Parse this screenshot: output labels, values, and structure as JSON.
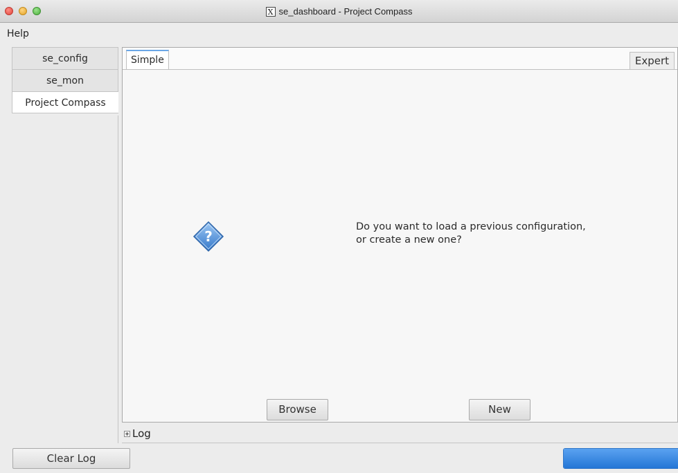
{
  "window": {
    "title": "se_dashboard - Project Compass",
    "app_icon": "x11-icon"
  },
  "menu": {
    "help_label": "Help"
  },
  "side_tabs": [
    {
      "label": "se_config",
      "active": false
    },
    {
      "label": "se_mon",
      "active": false
    },
    {
      "label": "Project Compass",
      "active": true
    }
  ],
  "main": {
    "tab_simple": "Simple",
    "tab_expert": "Expert",
    "icon": "question-icon",
    "prompt_line1": "Do you want to load a previous configuration,",
    "prompt_line2": "or create a new one?",
    "browse_label": "Browse",
    "new_label": "New"
  },
  "log": {
    "label": "Log"
  },
  "footer": {
    "clear_log_label": "Clear Log",
    "progress_fill": 1.0
  },
  "colors": {
    "accent": "#2476d6",
    "tab_highlight": "#6aa6e6",
    "question_icon": "#4a8fd9"
  }
}
